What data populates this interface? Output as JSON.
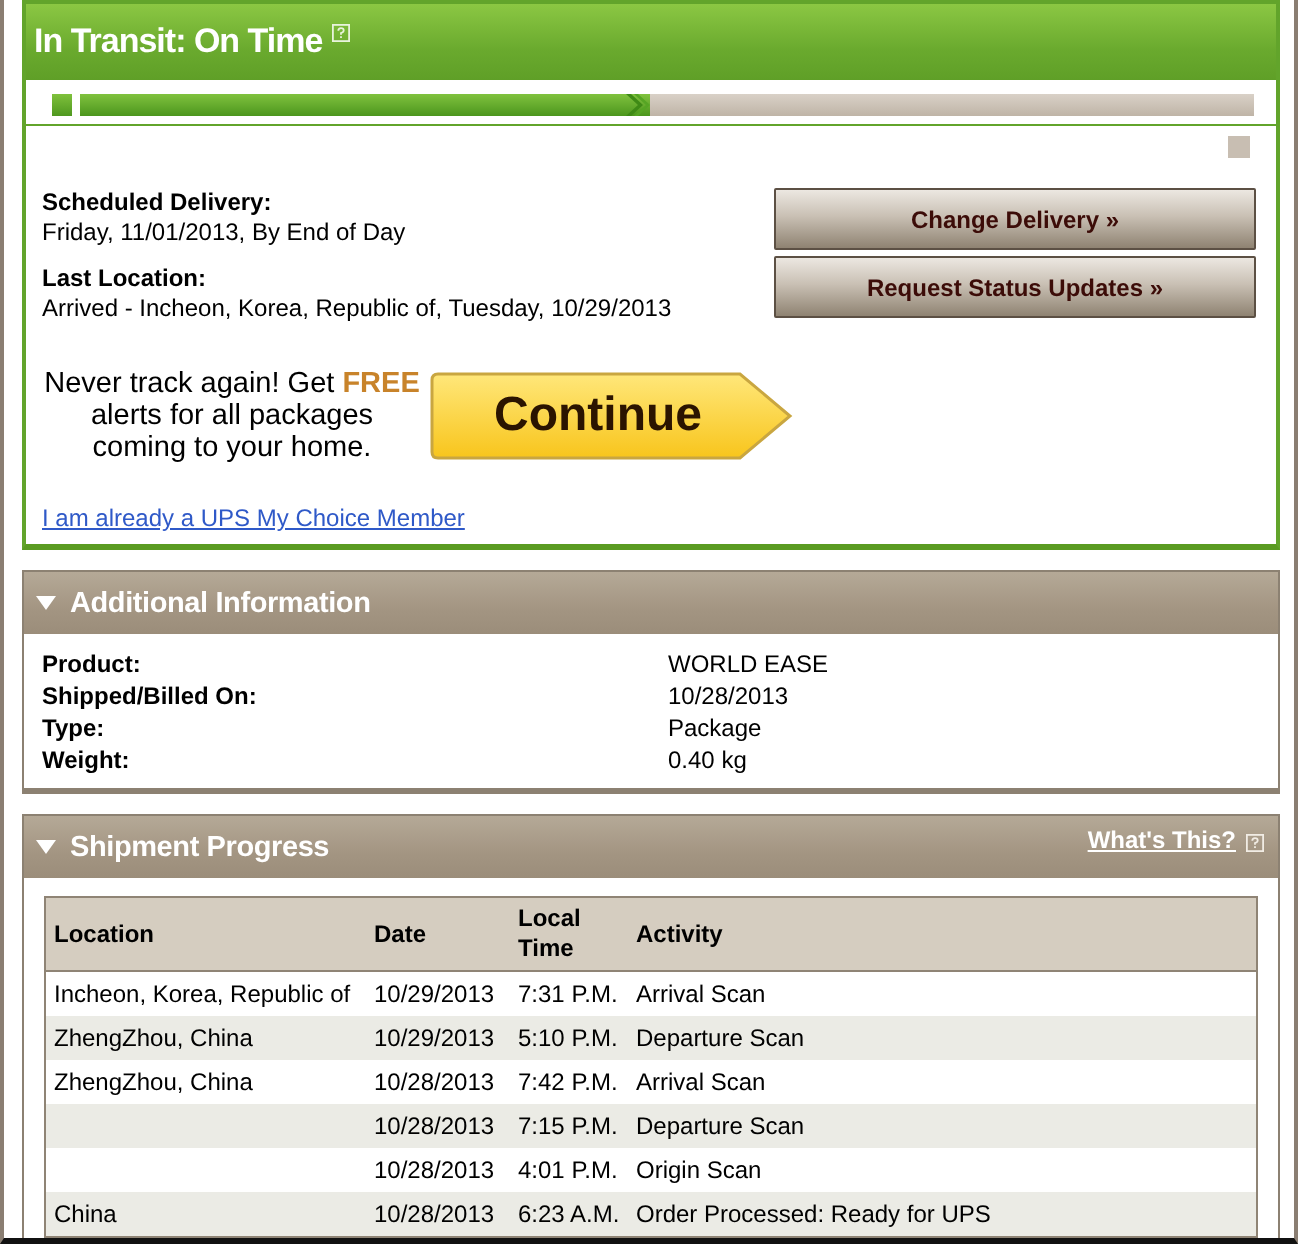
{
  "status_panel": {
    "title": "In Transit: On Time",
    "progress": {
      "level": 0.485
    },
    "scheduled_delivery": {
      "label": "Scheduled Delivery:",
      "value": "Friday, 11/01/2013, By End of Day"
    },
    "last_location": {
      "label": "Last Location:",
      "value": "Arrived - Incheon, Korea, Republic of, Tuesday, 10/29/2013"
    },
    "buttons": [
      "Change Delivery »",
      "Request Status Updates »"
    ],
    "promo": {
      "lines": [
        "Never track again! Get **FREE**",
        "alerts for all packages",
        "coming to your home."
      ],
      "button": "Continue"
    },
    "member_link": "I am already a UPS My Choice Member"
  },
  "additional_information": {
    "title": "Additional Information",
    "expanded": true,
    "rows": [
      {
        "label": "Product:",
        "value": "WORLD EASE"
      },
      {
        "label": "Shipped/Billed On:",
        "value": "10/28/2013"
      },
      {
        "label": "Type:",
        "value": "Package"
      },
      {
        "label": "Weight:",
        "value": "0.40 kg"
      }
    ]
  },
  "shipment_progress": {
    "title": "Shipment Progress",
    "expanded": true,
    "help_link": "What's This?",
    "table": {
      "columns": [
        "Location",
        "Date",
        "Local Time",
        "Activity"
      ],
      "rows": [
        {
          "location": "Incheon, Korea, Republic of",
          "date": "10/29/2013",
          "time": "7:31 P.M.",
          "activity": "Arrival Scan"
        },
        {
          "location": "ZhengZhou, China",
          "date": "10/29/2013",
          "time": "5:10 P.M.",
          "activity": "Departure Scan"
        },
        {
          "location": "ZhengZhou, China",
          "date": "10/28/2013",
          "time": "7:42 P.M.",
          "activity": "Arrival Scan"
        },
        {
          "date": "10/28/2013",
          "time": "7:15 P.M.",
          "activity": "Departure Scan"
        },
        {
          "date": "10/28/2013",
          "time": "4:01 P.M.",
          "activity": "Origin Scan"
        },
        {
          "location": "China",
          "date": "10/28/2013",
          "time": "6:23 A.M.",
          "activity": "Order Processed: Ready for UPS"
        }
      ]
    }
  }
}
